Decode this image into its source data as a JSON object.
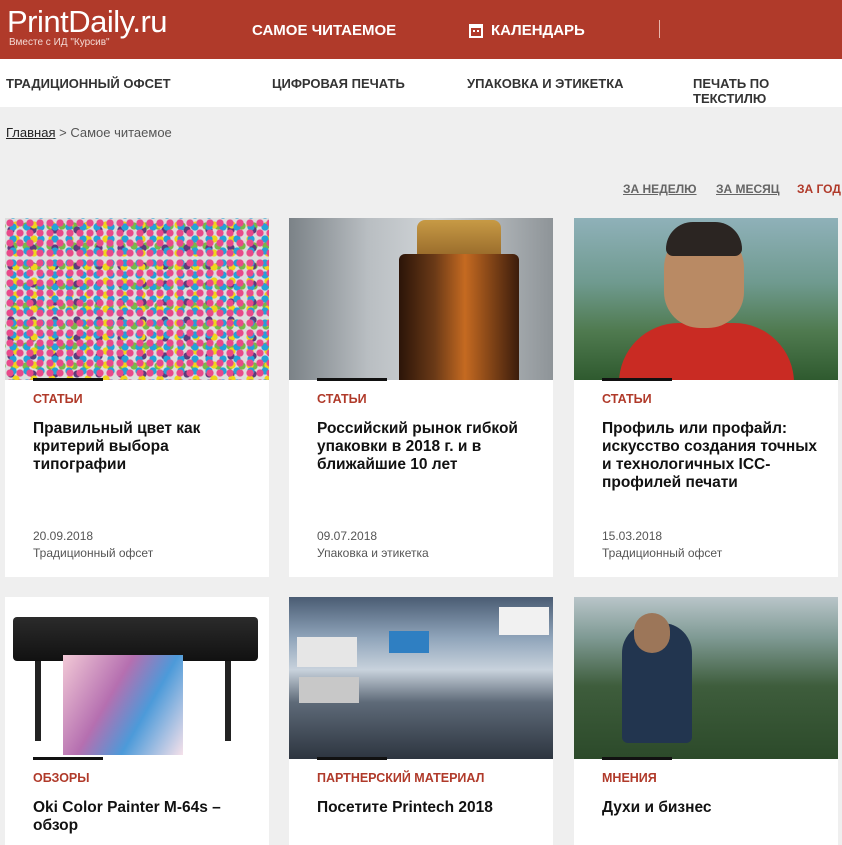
{
  "header": {
    "logo": "PrintDaily.ru",
    "logo_sub": "Вместе с ИД \"Курсив\"",
    "popular": "САМОЕ ЧИТАЕМОЕ",
    "calendar": "КАЛЕНДАРЬ",
    "calendar_icon": "calendar-icon"
  },
  "categories": [
    "ТРАДИЦИОННЫЙ ОФСЕТ",
    "ЦИФРОВАЯ ПЕЧАТЬ",
    "УПАКОВКА И ЭТИКЕТКА",
    "ПЕЧАТЬ ПО ТЕКСТИЛЮ"
  ],
  "breadcrumb": {
    "home": "Главная",
    "separator": " > ",
    "current": "Самое читаемое"
  },
  "periods": [
    {
      "label": "ЗА НЕДЕЛЮ",
      "active": false
    },
    {
      "label": "ЗА МЕСЯЦ",
      "active": false
    },
    {
      "label": "ЗА ГОД",
      "active": true
    }
  ],
  "colors": {
    "brand": "#b03a2a",
    "background": "#efefef"
  },
  "cards": [
    {
      "category": "СТАТЬИ",
      "title": "Правильный цвет как критерий выбора типографии",
      "date": "20.09.2018",
      "rubric": "Традиционный офсет"
    },
    {
      "category": "СТАТЬИ",
      "title": "Российский рынок гибкой упаковки в 2018 г. и в ближайшие 10 лет",
      "date": "09.07.2018",
      "rubric": "Упаковка и этикетка"
    },
    {
      "category": "СТАТЬИ",
      "title": "Профиль или профайл: искусство создания точных и технологичных ICC-профилей печати",
      "date": "15.03.2018",
      "rubric": "Традиционный офсет"
    },
    {
      "category": "ОБЗОРЫ",
      "title": "Oki Color Painter M-64s – обзор"
    },
    {
      "category": "ПАРТНЕРСКИЙ МАТЕРИАЛ",
      "title": "Посетите Printech 2018"
    },
    {
      "category": "МНЕНИЯ",
      "title": "Духи и бизнес"
    }
  ]
}
